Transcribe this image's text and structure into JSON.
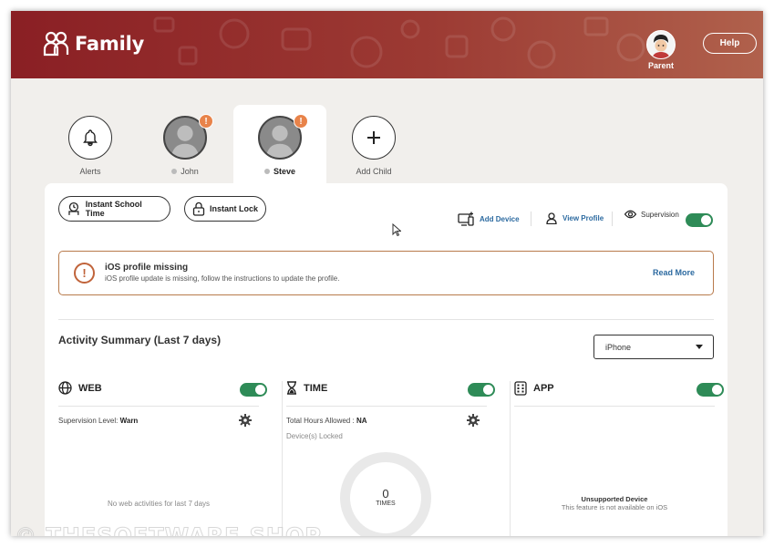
{
  "app": {
    "title": "Family",
    "logo_icon": "family-icon"
  },
  "header": {
    "parent_label": "Parent",
    "help_label": "Help",
    "colors": {
      "from": "#8a1f24",
      "to": "#b0614c"
    }
  },
  "tabs": [
    {
      "label": "Alerts",
      "icon": "bell-icon",
      "active": false
    },
    {
      "label": "John",
      "icon": "avatar-icon",
      "badge": "!",
      "active": false
    },
    {
      "label": "Steve",
      "icon": "avatar-icon",
      "badge": "!",
      "active": true
    },
    {
      "label": "Add Child",
      "icon": "plus-icon",
      "active": false
    }
  ],
  "toolbar": {
    "instant_school_time": "Instant School Time",
    "instant_lock": "Instant Lock",
    "add_device": "Add Device",
    "view_profile": "View Profile",
    "supervision": "Supervision",
    "supervision_on": true
  },
  "alert": {
    "title": "iOS profile missing",
    "message": "iOS profile update is missing, follow the instructions to update the profile.",
    "action": "Read More",
    "icon": "exclamation-icon"
  },
  "activity": {
    "title": "Activity Summary  (Last 7 days)",
    "device_selected": "iPhone"
  },
  "columns": {
    "web": {
      "title": "WEB",
      "icon": "globe-icon",
      "enabled": true,
      "level_label": "Supervision Level:",
      "level_value": "Warn",
      "empty": "No web activities for last 7 days"
    },
    "time": {
      "title": "TIME",
      "icon": "hourglass-icon",
      "enabled": true,
      "hours_label": "Total Hours Allowed :",
      "hours_value": "NA",
      "locked": "Device(s) Locked",
      "gauge_value": "0",
      "gauge_unit": "TIMES"
    },
    "app": {
      "title": "APP",
      "icon": "app-grid-icon",
      "enabled": true,
      "unsupported_title": "Unsupported Device",
      "unsupported_message": "This feature is not available on iOS"
    }
  },
  "watermark": "© THESOFTWARE.SHOP"
}
